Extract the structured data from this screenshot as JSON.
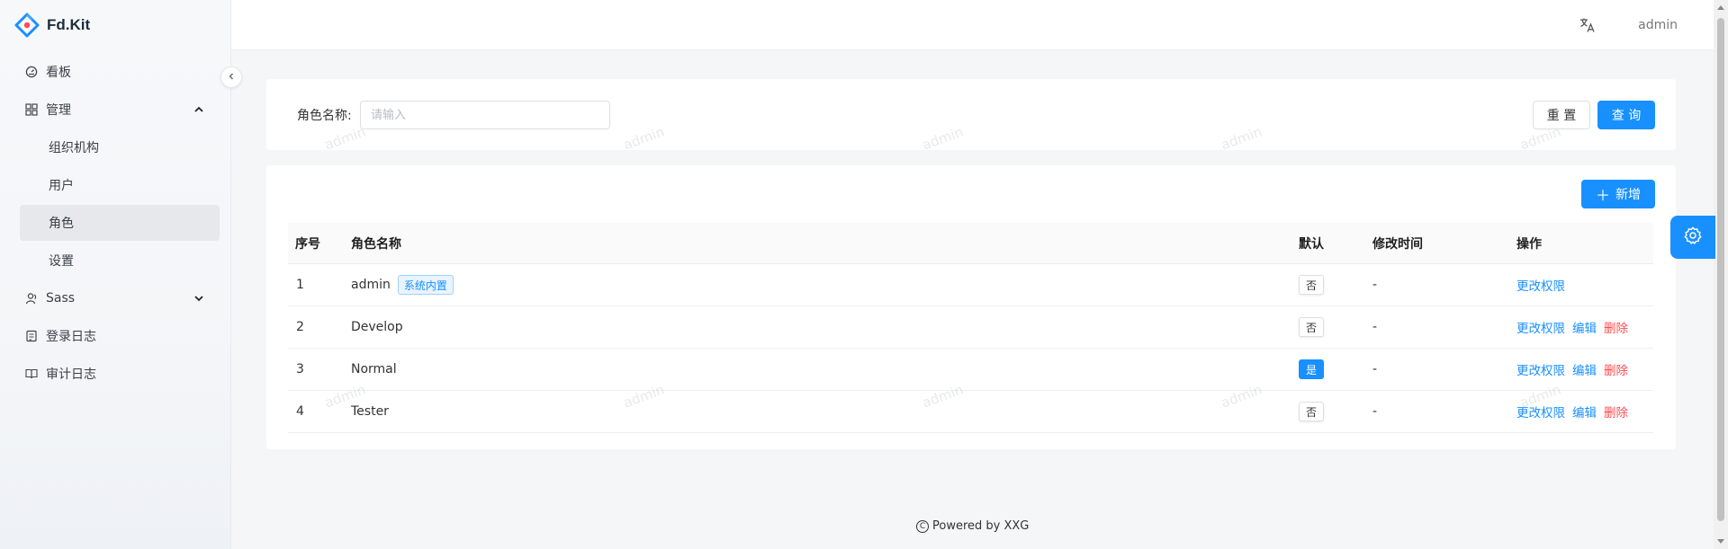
{
  "app": {
    "name": "Fd.Kit",
    "user": "admin"
  },
  "sidebar": {
    "items": [
      {
        "label": "看板",
        "icon": "dashboard-icon"
      },
      {
        "label": "管理",
        "icon": "grid-icon",
        "expanded": true
      },
      {
        "label": "组织机构"
      },
      {
        "label": "用户"
      },
      {
        "label": "角色",
        "active": true
      },
      {
        "label": "设置"
      },
      {
        "label": "Sass",
        "icon": "users-icon",
        "expanded": false
      },
      {
        "label": "登录日志",
        "icon": "login-log-icon"
      },
      {
        "label": "审计日志",
        "icon": "audit-log-icon"
      }
    ]
  },
  "search": {
    "label": "角色名称:",
    "placeholder": "请输入",
    "reset_label": "重 置",
    "query_label": "查 询"
  },
  "table": {
    "add_label": "新增",
    "columns": [
      "序号",
      "角色名称",
      "默认",
      "修改时间",
      "操作"
    ],
    "rows": [
      {
        "index": "1",
        "name": "admin",
        "tag": "系统内置",
        "default": "否",
        "is_default": false,
        "modified": "-",
        "actions": [
          "更改权限"
        ]
      },
      {
        "index": "2",
        "name": "Develop",
        "tag": "",
        "default": "否",
        "is_default": false,
        "modified": "-",
        "actions": [
          "更改权限",
          "编辑",
          "删除"
        ]
      },
      {
        "index": "3",
        "name": "Normal",
        "tag": "",
        "default": "是",
        "is_default": true,
        "modified": "-",
        "actions": [
          "更改权限",
          "编辑",
          "删除"
        ]
      },
      {
        "index": "4",
        "name": "Tester",
        "tag": "",
        "default": "否",
        "is_default": false,
        "modified": "-",
        "actions": [
          "更改权限",
          "编辑",
          "删除"
        ]
      }
    ]
  },
  "footer": {
    "text": "Powered by XXG"
  },
  "watermark": "admin",
  "colors": {
    "primary": "#1890ff",
    "danger": "#ff4d4f"
  }
}
